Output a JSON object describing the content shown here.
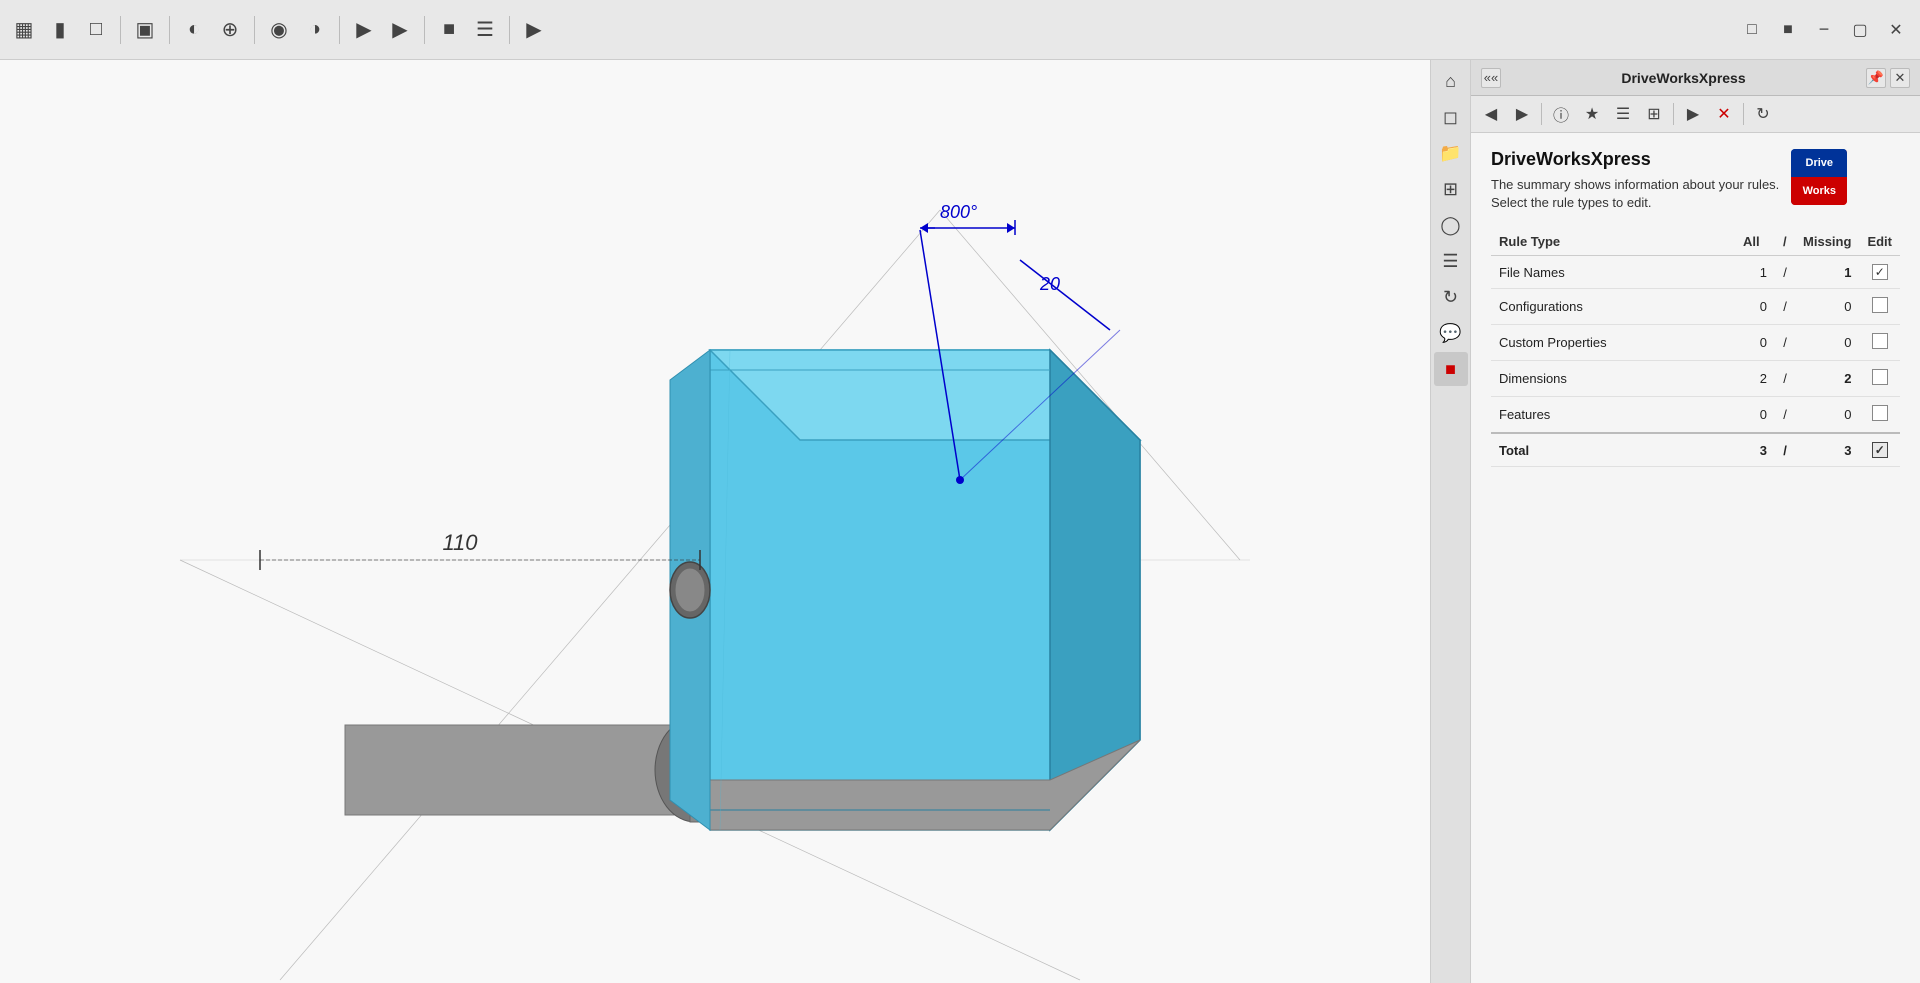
{
  "toolbar": {
    "title": "DriveWorksXpress"
  },
  "panel": {
    "title": "DriveWorksXpress",
    "logo_top": "Drive",
    "logo_bottom": "Works",
    "heading": "DriveWorksXpress",
    "description_line1": "The summary shows information about your rules.",
    "description_line2": "Select the rule types to edit.",
    "table": {
      "col_rule_type": "Rule Type",
      "col_all": "All",
      "col_slash": "/",
      "col_missing": "Missing",
      "col_edit": "Edit",
      "rows": [
        {
          "name": "File Names",
          "all": "1",
          "missing": "1",
          "missing_red": true,
          "checked": true,
          "has_check": true
        },
        {
          "name": "Configurations",
          "all": "0",
          "missing": "0",
          "missing_red": false,
          "checked": false,
          "has_check": true
        },
        {
          "name": "Custom Properties",
          "all": "0",
          "missing": "0",
          "missing_red": false,
          "checked": false,
          "has_check": true
        },
        {
          "name": "Dimensions",
          "all": "2",
          "missing": "2",
          "missing_red": true,
          "checked": false,
          "has_check": true
        },
        {
          "name": "Features",
          "all": "0",
          "missing": "0",
          "missing_red": false,
          "checked": false,
          "has_check": true
        }
      ],
      "total": {
        "name": "Total",
        "all": "3",
        "missing": "3",
        "missing_red": true,
        "checked": true,
        "has_check": true
      }
    }
  },
  "icons": {
    "back": "◀",
    "forward": "▶",
    "info": "ℹ",
    "bookmark": "☆",
    "lines": "≡",
    "table": "⊞",
    "play": "▶",
    "close_x": "✕",
    "refresh": "↻",
    "collapse": "«",
    "pin": "📌",
    "check": "✓",
    "home": "⌂",
    "box3d": "◫",
    "folder": "📁",
    "grid": "⊞",
    "globe": "◎",
    "list": "≡",
    "cycle": "↺",
    "chat": "💬",
    "red_sq": "■"
  },
  "viewport": {
    "dimension_labels": [
      "800°",
      "20",
      "110"
    ]
  }
}
